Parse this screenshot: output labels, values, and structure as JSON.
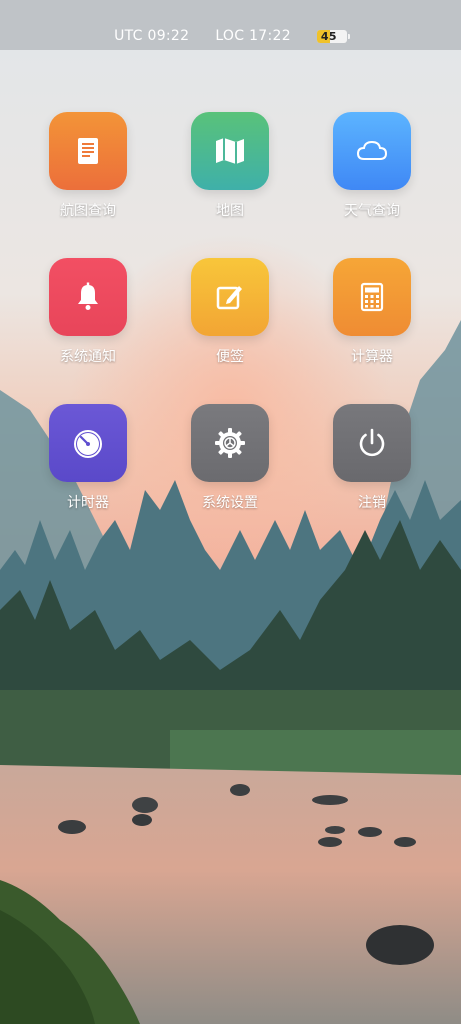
{
  "status_bar": {
    "utc_time": "UTC 09:22",
    "local_time": "LOC 17:22",
    "battery_level": 45,
    "battery_label": "45"
  },
  "apps": [
    {
      "label": "航图查询",
      "icon": "document-icon",
      "color_top": "#f39438",
      "color_bottom": "#ec6f3a"
    },
    {
      "label": "地图",
      "icon": "map-icon",
      "color_top": "#59c27a",
      "color_bottom": "#3fb0a9"
    },
    {
      "label": "天气查询",
      "icon": "cloud-icon",
      "color_top": "#5cb4ff",
      "color_bottom": "#3f88f5"
    },
    {
      "label": "系统通知",
      "icon": "bell-icon",
      "color_top": "#f24f63",
      "color_bottom": "#e8455a"
    },
    {
      "label": "便签",
      "icon": "note-edit-icon",
      "color_top": "#f8c63a",
      "color_bottom": "#f2a534"
    },
    {
      "label": "计算器",
      "icon": "calculator-icon",
      "color_top": "#f6a637",
      "color_bottom": "#ef8c33"
    },
    {
      "label": "计时器",
      "icon": "timer-icon",
      "color_top": "#6b58d6",
      "color_bottom": "#5a49c9"
    },
    {
      "label": "系统设置",
      "icon": "gear-icon",
      "color_top": "#7a7a7e",
      "color_bottom": "#6b6b6f"
    },
    {
      "label": "注销",
      "icon": "power-icon",
      "color_top": "#78787c",
      "color_bottom": "#69696d"
    }
  ]
}
